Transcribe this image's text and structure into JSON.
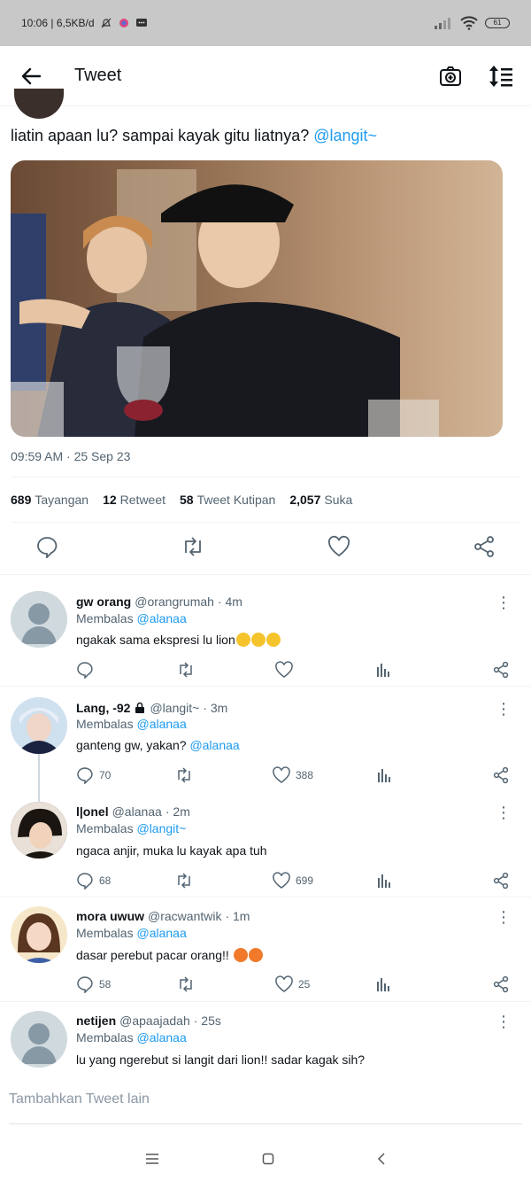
{
  "status_bar": {
    "time_info": "10:06 | 6,5KB/d",
    "battery": "61"
  },
  "header": {
    "title": "Tweet"
  },
  "tweet": {
    "text": "liatin apaan lu? sampai kayak gitu liatnya?",
    "mention": "@langit~",
    "timestamp": "09:59 AM · 25 Sep 23",
    "stats": [
      {
        "value": "689",
        "label": "Tayangan"
      },
      {
        "value": "12",
        "label": "Retweet"
      },
      {
        "value": "58",
        "label": "Tweet Kutipan"
      },
      {
        "value": "2,057",
        "label": "Suka"
      }
    ]
  },
  "replies": [
    {
      "name": "gw orang",
      "handle": "@orangrumah",
      "time": "· 4m",
      "replying_prefix": "Membalas",
      "replying_to": "@alanaa",
      "text": "ngakak sama ekspresi lu lion",
      "replies": "",
      "likes": ""
    },
    {
      "name": "Lang, -92",
      "handle": "@langit~",
      "time": "· 3m",
      "replying_prefix": "Membalas",
      "replying_to": "@alanaa",
      "text": "ganteng gw, yakan?",
      "text_mention": "@alanaa",
      "replies": "70",
      "likes": "388"
    },
    {
      "name": "l|onel",
      "handle": "@alanaa",
      "time": "· 2m",
      "replying_prefix": "Membalas",
      "replying_to": "@langit~",
      "text": "ngaca anjir, muka lu kayak apa tuh",
      "replies": "68",
      "likes": "699"
    },
    {
      "name": "mora uwuw",
      "handle": "@racwantwik",
      "time": "· 1m",
      "replying_prefix": "Membalas",
      "replying_to": "@alanaa",
      "text": "dasar perebut pacar orang!!",
      "replies": "58",
      "likes": "25"
    },
    {
      "name": "netijen",
      "handle": "@apaajadah",
      "time": "· 25s",
      "replying_prefix": "Membalas",
      "replying_to": "@alanaa",
      "text": "lu yang ngerebut si langit dari lion!! sadar kagak sih?"
    }
  ],
  "compose": {
    "placeholder": "Tambahkan Tweet lain"
  },
  "colors": {
    "link": "#1d9bf0",
    "muted": "#536471",
    "status_bar": "#c8c8c8"
  }
}
